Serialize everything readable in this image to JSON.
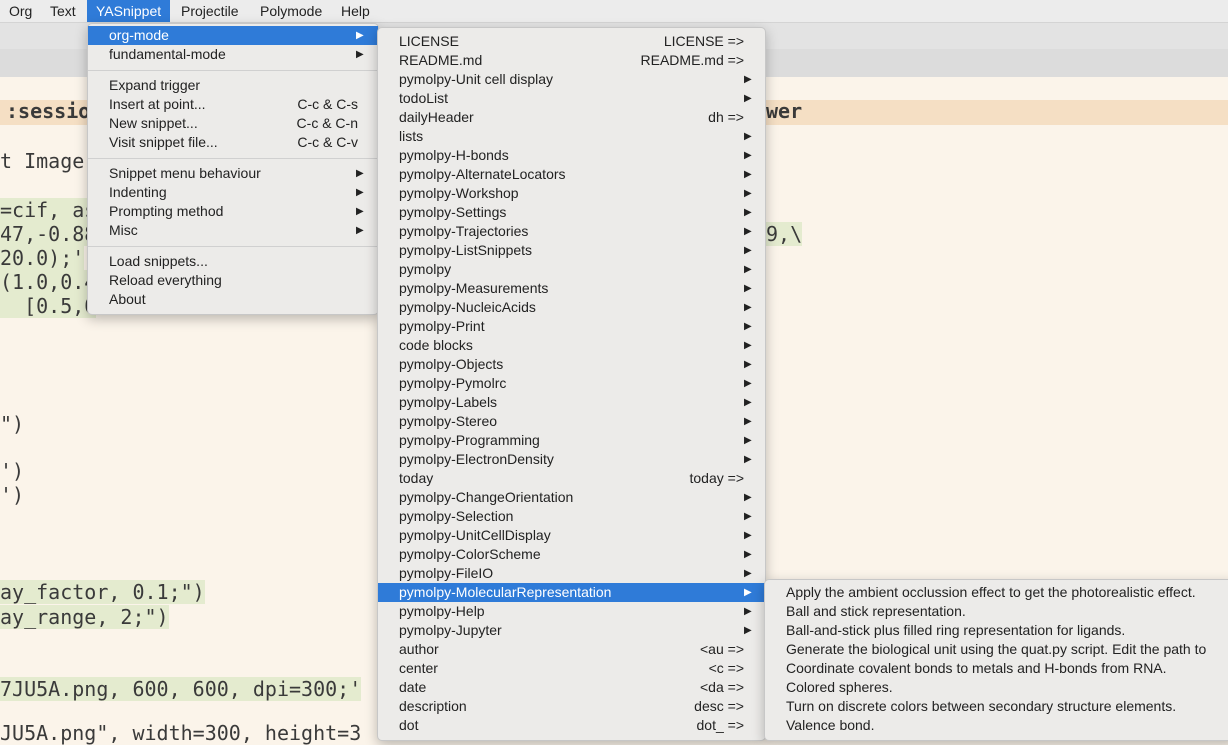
{
  "menubar": {
    "items": [
      "Org",
      "Text",
      "YASnippet",
      "Projectile",
      "Polymode",
      "Help"
    ]
  },
  "editor": {
    "lines": [
      ":sessio",
      "t Image",
      "=cif, as",
      "47,-0.88",
      "20.0);'",
      "(1.0,0.4",
      "  [0.5,0",
      "\")",
      "')",
      "')",
      "ay_factor, 0.1;\")",
      "ay_range, 2;\")",
      "7JU5A.png, 600, 600, dpi=300;'",
      "JU5A.png\", width=300, height=3",
      "wer",
      "9,\\"
    ]
  },
  "yasnippet_menu": {
    "group1": [
      {
        "label": "org-mode",
        "shortcut": "",
        "submenu": true,
        "selected": true
      },
      {
        "label": "fundamental-mode",
        "shortcut": "",
        "submenu": true
      }
    ],
    "group2": [
      {
        "label": "Expand trigger",
        "shortcut": ""
      },
      {
        "label": "Insert at point...",
        "shortcut": "C-c & C-s"
      },
      {
        "label": "New snippet...",
        "shortcut": "C-c & C-n"
      },
      {
        "label": "Visit snippet file...",
        "shortcut": "C-c & C-v"
      }
    ],
    "group3": [
      {
        "label": "Snippet menu behaviour",
        "submenu": true
      },
      {
        "label": "Indenting",
        "submenu": true
      },
      {
        "label": "Prompting method",
        "submenu": true
      },
      {
        "label": "Misc",
        "submenu": true
      }
    ],
    "group4": [
      {
        "label": "Load snippets..."
      },
      {
        "label": "Reload everything"
      },
      {
        "label": "About"
      }
    ]
  },
  "orgmode_menu": {
    "items": [
      {
        "label": "LICENSE",
        "shortcut": "LICENSE =>"
      },
      {
        "label": "README.md",
        "shortcut": "README.md =>"
      },
      {
        "label": "pymolpy-Unit cell display",
        "submenu": true
      },
      {
        "label": "todoList",
        "submenu": true
      },
      {
        "label": "dailyHeader",
        "shortcut": "dh =>"
      },
      {
        "label": "lists",
        "submenu": true
      },
      {
        "label": "pymolpy-H-bonds",
        "submenu": true
      },
      {
        "label": "pymolpy-AlternateLocators",
        "submenu": true
      },
      {
        "label": "pymolpy-Workshop",
        "submenu": true
      },
      {
        "label": "pymolpy-Settings",
        "submenu": true
      },
      {
        "label": "pymolpy-Trajectories",
        "submenu": true
      },
      {
        "label": "pymolpy-ListSnippets",
        "submenu": true
      },
      {
        "label": "pymolpy",
        "submenu": true
      },
      {
        "label": "pymolpy-Measurements",
        "submenu": true
      },
      {
        "label": "pymolpy-NucleicAcids",
        "submenu": true
      },
      {
        "label": "pymolpy-Print",
        "submenu": true
      },
      {
        "label": "code blocks",
        "submenu": true
      },
      {
        "label": "pymolpy-Objects",
        "submenu": true
      },
      {
        "label": "pymolpy-Pymolrc",
        "submenu": true
      },
      {
        "label": "pymolpy-Labels",
        "submenu": true
      },
      {
        "label": "pymolpy-Stereo",
        "submenu": true
      },
      {
        "label": "pymolpy-Programming",
        "submenu": true
      },
      {
        "label": "pymolpy-ElectronDensity",
        "submenu": true
      },
      {
        "label": "today",
        "shortcut": "today =>"
      },
      {
        "label": "pymolpy-ChangeOrientation",
        "submenu": true
      },
      {
        "label": "pymolpy-Selection",
        "submenu": true
      },
      {
        "label": "pymolpy-UnitCellDisplay",
        "submenu": true
      },
      {
        "label": "pymolpy-ColorScheme",
        "submenu": true
      },
      {
        "label": "pymolpy-FileIO",
        "submenu": true
      },
      {
        "label": "pymolpy-MolecularRepresentation",
        "submenu": true,
        "selected": true
      },
      {
        "label": "pymolpy-Help",
        "submenu": true
      },
      {
        "label": "pymolpy-Jupyter",
        "submenu": true
      },
      {
        "label": "author",
        "shortcut": "<au =>"
      },
      {
        "label": "center",
        "shortcut": "<c =>"
      },
      {
        "label": "date",
        "shortcut": "<da =>"
      },
      {
        "label": "description",
        "shortcut": "desc =>"
      },
      {
        "label": "dot",
        "shortcut": "dot_ =>"
      }
    ]
  },
  "molrep_menu": {
    "items": [
      "Apply the ambient occlussion effect to get the photorealistic effect.",
      "Ball and stick representation.",
      "Ball-and-stick plus filled ring representation for ligands.",
      "Generate the biological unit using the quat.py script. Edit the path to",
      "Coordinate covalent bonds to metals and H-bonds from RNA.",
      "Colored spheres.",
      "Turn on discrete colors between secondary structure elements.",
      "Valence bond."
    ]
  },
  "glyphs": {
    "submenu_arrow": "▶"
  },
  "colors": {
    "accent": "#2f7bd8",
    "menu_bg": "#ecebe9",
    "editor_bg": "#fbf4ea",
    "code_highlight": "#e4ebcf"
  }
}
